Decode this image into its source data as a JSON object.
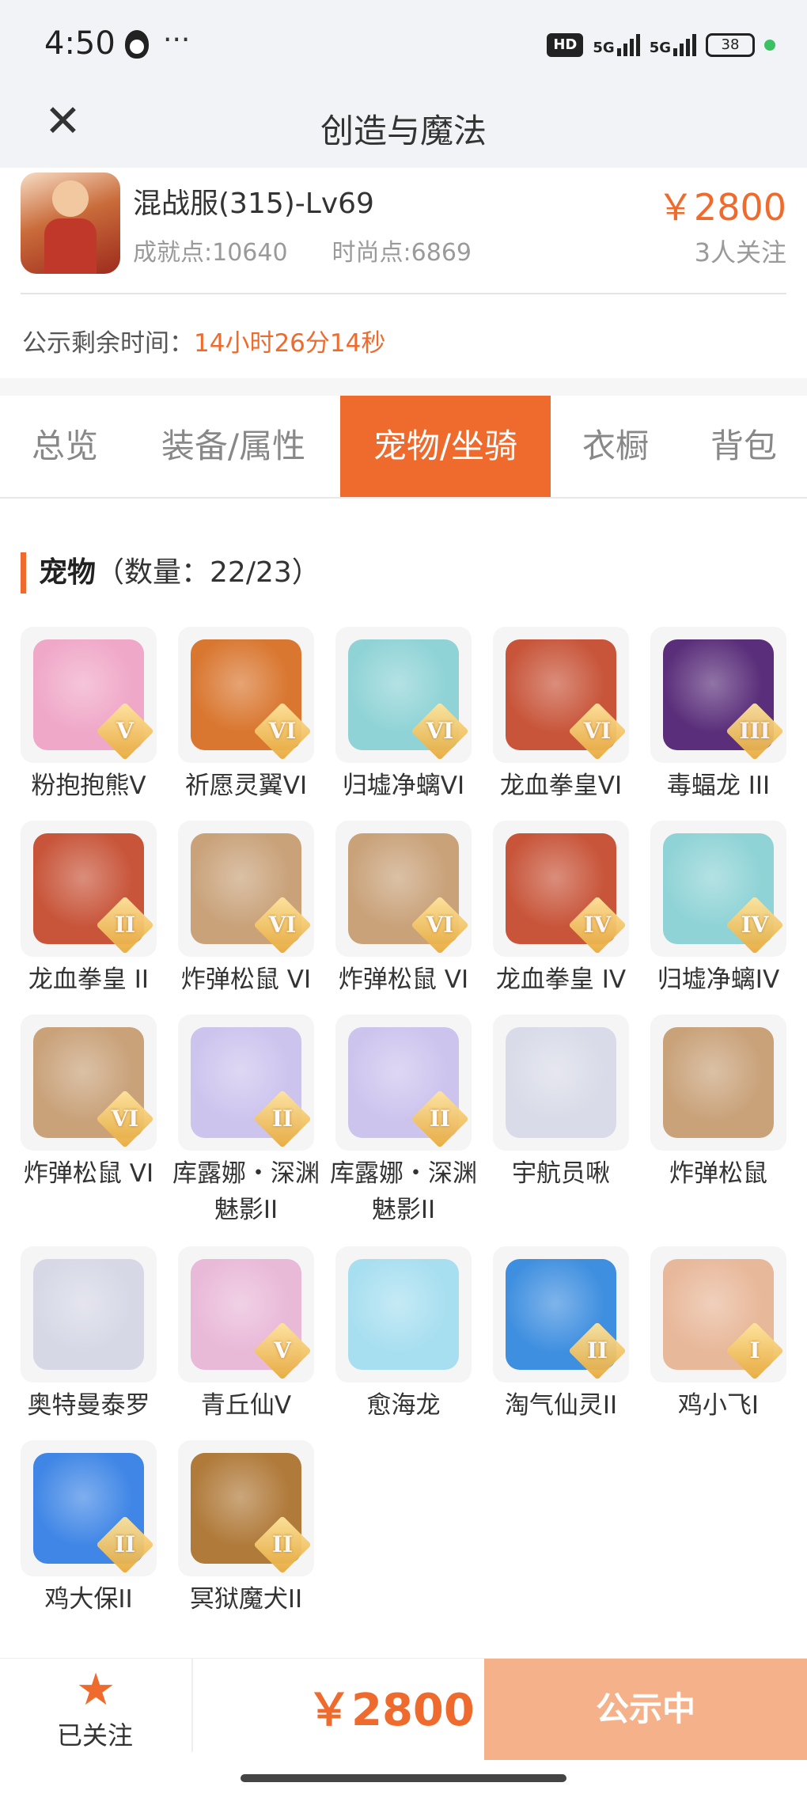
{
  "status_bar": {
    "time": "4:50",
    "more": "···",
    "hd": "HD",
    "net1": "5G",
    "net2": "5G",
    "battery": "38"
  },
  "nav": {
    "close_icon": "close-icon",
    "title": "创造与魔法"
  },
  "account": {
    "server": "混战服(315)-Lv69",
    "achievement": "成就点:10640",
    "fashion": "时尚点:6869",
    "price": "￥2800",
    "followers": "3人关注",
    "remaining_label": "公示剩余时间：",
    "remaining_value": "14小时26分14秒"
  },
  "tabs": [
    {
      "label": "总览"
    },
    {
      "label": "装备/属性"
    },
    {
      "label": "宠物/坐骑",
      "active": true
    },
    {
      "label": "衣橱"
    },
    {
      "label": "背包"
    }
  ],
  "section": {
    "title": "宠物",
    "count": "（数量：22/23）"
  },
  "pets": [
    {
      "name": "粉抱抱熊Ⅴ",
      "badge": "V",
      "color": "#f0a8c8"
    },
    {
      "name": "祈愿灵翼VI",
      "badge": "VI",
      "color": "#d9762f"
    },
    {
      "name": "归墟净螭VI",
      "badge": "VI",
      "color": "#8fd3d6"
    },
    {
      "name": "龙血拳皇VI",
      "badge": "VI",
      "color": "#c8553a"
    },
    {
      "name": "毒蝠龙 III",
      "badge": "III",
      "color": "#5a2e7a"
    },
    {
      "name": "龙血拳皇 II",
      "badge": "II",
      "color": "#c8553a"
    },
    {
      "name": "炸弹松鼠 VI",
      "badge": "VI",
      "color": "#c9a27a"
    },
    {
      "name": "炸弹松鼠 VI",
      "badge": "VI",
      "color": "#c9a27a"
    },
    {
      "name": "龙血拳皇 IV",
      "badge": "IV",
      "color": "#c8553a"
    },
    {
      "name": "归墟净螭IV",
      "badge": "IV",
      "color": "#8fd3d6"
    },
    {
      "name": "炸弹松鼠 VI",
      "badge": "VI",
      "color": "#c9a27a"
    },
    {
      "name": "库露娜・深渊魅影II",
      "badge": "II",
      "color": "#cdc4ee"
    },
    {
      "name": "库露娜・深渊魅影II",
      "badge": "II",
      "color": "#cdc4ee"
    },
    {
      "name": "宇航员啾",
      "badge": "",
      "color": "#d9dbe8"
    },
    {
      "name": "炸弹松鼠",
      "badge": "",
      "color": "#c9a27a"
    },
    {
      "name": "奥特曼泰罗",
      "badge": "",
      "color": "#d6d8e6"
    },
    {
      "name": "青丘仙V",
      "badge": "V",
      "color": "#e9b9d8"
    },
    {
      "name": "愈海龙",
      "badge": "",
      "color": "#a8dff0"
    },
    {
      "name": "淘气仙灵II",
      "badge": "II",
      "color": "#3f8fe0"
    },
    {
      "name": "鸡小飞I",
      "badge": "I",
      "color": "#e8b89a"
    },
    {
      "name": "鸡大保II",
      "badge": "II",
      "color": "#3f86e6"
    },
    {
      "name": "冥狱魔犬II",
      "badge": "II",
      "color": "#b07a3a"
    }
  ],
  "bottom": {
    "followed": "已关注",
    "price": "￥2800",
    "button": "公示中"
  },
  "colors": {
    "accent": "#ef6b2d",
    "button_bg": "#f4b18a"
  }
}
